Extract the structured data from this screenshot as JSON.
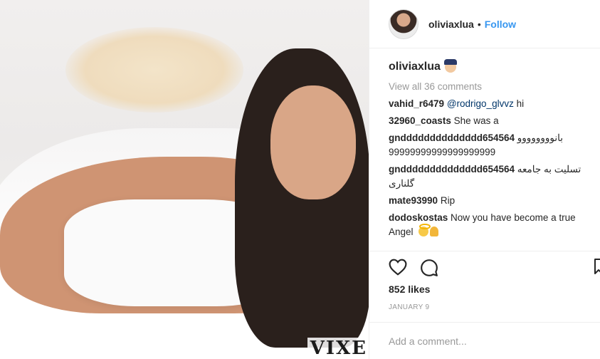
{
  "post": {
    "photo": {
      "watermark": "VIXE"
    }
  },
  "header": {
    "username": "oliviaxlua",
    "separator": "•",
    "follow_label": "Follow"
  },
  "caption": {
    "username": "oliviaxlua",
    "emoji": "police-officer-icon"
  },
  "view_all_label": "View all 36 comments",
  "comments": [
    {
      "user": "vahid_r6479",
      "mention": "@rodrigo_glvvz",
      "text": " hi"
    },
    {
      "user": "32960_coasts",
      "text": "She was a"
    },
    {
      "user": "gndddddddddddddd654564",
      "text": "بانوووووووو 99999999999999999999"
    },
    {
      "user": "gndddddddddddddd654564",
      "text": "تسلیت به جامعه گلناری"
    },
    {
      "user": "mate93990",
      "text": "Rip"
    },
    {
      "user": "dodoskostas",
      "text": "Now you have become a true Angel",
      "emoji": [
        "angel-icon",
        "pray-icon"
      ]
    }
  ],
  "actions": {
    "icons": [
      "heart-icon",
      "comment-icon",
      "bookmark-icon"
    ]
  },
  "likes_label": "852 likes",
  "date_label": "JANUARY 9",
  "add_comment": {
    "placeholder": "Add a comment..."
  },
  "colors": {
    "link": "#3897f0",
    "muted": "#999999",
    "text": "#262626",
    "mention": "#003569"
  }
}
